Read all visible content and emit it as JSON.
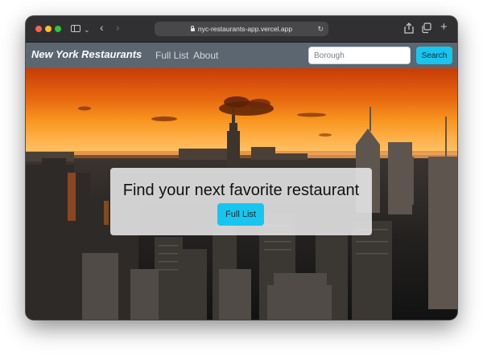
{
  "browser": {
    "url": "nyc-restaurants-app.vercel.app",
    "icons": [
      "sidebar-icon",
      "chevron-down-icon",
      "back-icon",
      "forward-icon",
      "lock-icon",
      "reload-icon",
      "share-icon",
      "tabs-icon",
      "new-tab-icon"
    ]
  },
  "navbar": {
    "brand": "New York Restaurants",
    "links": [
      "Full List",
      "About"
    ],
    "search_placeholder": "Borough",
    "search_button": "Search"
  },
  "hero": {
    "title": "Find your next favorite restaurant",
    "button": "Full List"
  },
  "colors": {
    "navbar": "#5b6670",
    "accent": "#17c6ef",
    "sky_top": "#c73c07",
    "sky_horizon": "#ffb14a"
  }
}
